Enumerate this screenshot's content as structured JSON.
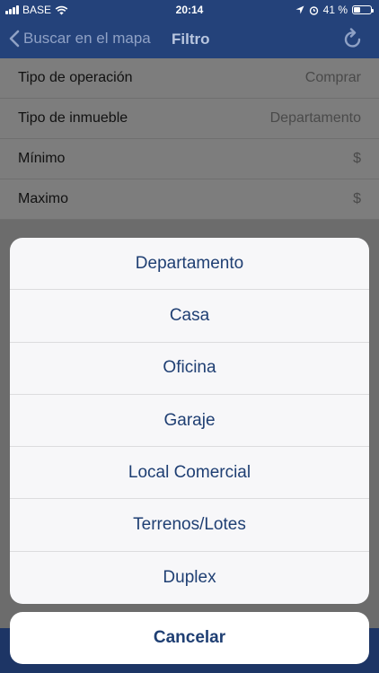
{
  "status_bar": {
    "carrier": "BASE",
    "time": "20:14",
    "battery": "41 %",
    "battery_level": 0.41
  },
  "nav": {
    "back_label": "Buscar en el mapa",
    "title": "Filtro",
    "back_icon": "chevron-left-icon",
    "refresh_icon": "refresh-icon"
  },
  "form": {
    "rows": [
      {
        "label": "Tipo de operación",
        "value": "Comprar"
      },
      {
        "label": "Tipo de inmueble",
        "value": "Departamento"
      },
      {
        "label": "Mínimo",
        "value": "$"
      },
      {
        "label": "Maximo",
        "value": "$"
      }
    ]
  },
  "action_sheet": {
    "options": [
      "Departamento",
      "Casa",
      "Oficina",
      "Garaje",
      "Local Comercial",
      "Terrenos/Lotes",
      "Duplex"
    ],
    "cancel_label": "Cancelar"
  },
  "colors": {
    "nav_background": "#24427a",
    "option_text": "#1f3f73"
  }
}
